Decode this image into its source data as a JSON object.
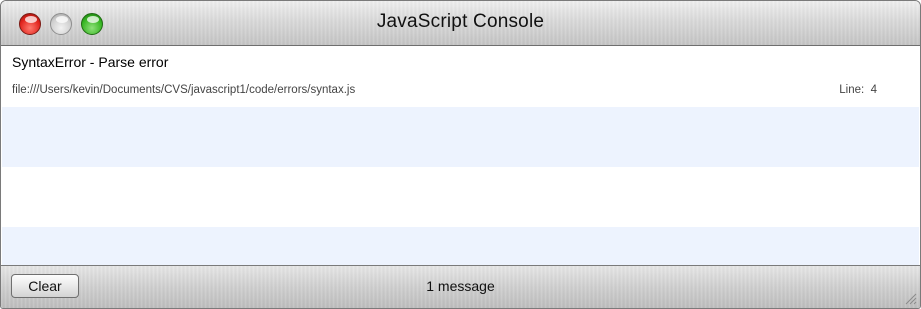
{
  "window": {
    "title": "JavaScript Console"
  },
  "messages": [
    {
      "text": "SyntaxError - Parse error",
      "file": "file:///Users/kevin/Documents/CVS/javascript1/code/errors/syntax.js",
      "line_label": "Line:  4"
    }
  ],
  "footer": {
    "clear_label": "Clear",
    "status": "1 message"
  },
  "colors": {
    "row_alternate": "#edf3fe",
    "close": "#e0231c",
    "minimize": "#cfcfcf",
    "zoom": "#36b522"
  },
  "icons": [
    "close-button-icon",
    "minimize-button-icon",
    "zoom-button-icon",
    "resize-grip-icon"
  ]
}
